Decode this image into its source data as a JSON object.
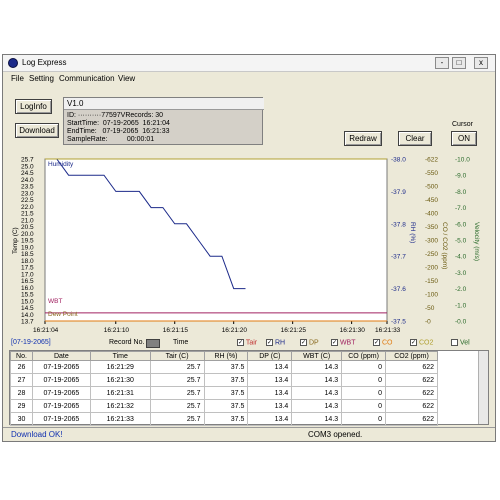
{
  "window": {
    "title": "Log Express",
    "controls": [
      "-",
      "□",
      "x"
    ]
  },
  "menu": [
    "File",
    "Setting",
    "Communication",
    "View"
  ],
  "buttons": {
    "loginfo": "LogInfo",
    "download": "Download",
    "redraw": "Redraw",
    "clear": "Clear",
    "cursor_label": "Cursor",
    "cursor_on": "ON"
  },
  "info": {
    "version": "V1.0",
    "id_line": "ID: ··········77597VRecords: 30",
    "start_time": "StartTime:  07-19-2065  16:21:04",
    "end_time": "EndTime:   07-19-2065  16:21:33",
    "sample_rate": "SampleRate:          00:00:01"
  },
  "chart_data": {
    "type": "line",
    "x": [
      "16:21:04",
      "16:21:10",
      "16:21:15",
      "16:21:20",
      "16:21:25",
      "16:21:30",
      "16:21:33"
    ],
    "xlabel": "",
    "date": "[07-19-2065]",
    "axes": {
      "left": {
        "label": "Temp (C)",
        "ticks": [
          "25.7",
          "25.0",
          "24.5",
          "24.0",
          "23.5",
          "23.0",
          "22.5",
          "22.0",
          "21.5",
          "21.0",
          "20.5",
          "20.0",
          "19.5",
          "19.0",
          "18.5",
          "18.0",
          "17.5",
          "17.0",
          "16.5",
          "16.0",
          "15.5",
          "15.0",
          "14.5",
          "14.0",
          "13.7"
        ],
        "ylim": [
          13.7,
          25.7
        ]
      },
      "right1": {
        "label": "RH (%)",
        "ticks": [
          "-38.0",
          "-37.9",
          "-37.8",
          "-37.7",
          "-37.6",
          "-37.5"
        ],
        "ylim": [
          37.5,
          38.0
        ]
      },
      "right2": {
        "label": "CO / CO2 (ppm)",
        "ticks": [
          "-622",
          "-550",
          "-500",
          "-450",
          "-400",
          "-350",
          "-300",
          "-250",
          "-200",
          "-150",
          "-100",
          "-50",
          "-0"
        ],
        "ylim": [
          0,
          622
        ]
      },
      "right3": {
        "label": "Velocity (m/s)",
        "ticks": [
          "-10.0",
          "-9.0",
          "-8.0",
          "-7.0",
          "-6.0",
          "-5.0",
          "-4.0",
          "-3.0",
          "-2.0",
          "-1.0",
          "-0.0"
        ],
        "ylim": [
          0,
          10
        ]
      }
    },
    "annotations": [
      "Humidity",
      "WBT",
      "Dew Point"
    ],
    "series": [
      {
        "name": "RH",
        "color": "#1c2a8a",
        "axis": "right1",
        "x_sec": [
          0,
          1,
          2,
          3,
          4,
          5,
          6,
          7,
          8,
          9,
          10,
          11,
          12,
          13,
          14,
          15,
          16,
          17
        ],
        "values": [
          38.0,
          38.0,
          37.95,
          37.95,
          37.95,
          37.95,
          37.9,
          37.9,
          37.9,
          37.85,
          37.85,
          37.8,
          37.8,
          37.75,
          37.7,
          37.7,
          37.6,
          37.6
        ]
      },
      {
        "name": "Tair",
        "color": "#c03030",
        "axis": "left",
        "x_sec": [
          0,
          29
        ],
        "values": [
          25.7,
          25.7
        ]
      },
      {
        "name": "DP",
        "color": "#8a6a20",
        "axis": "left",
        "x_sec": [
          0,
          29
        ],
        "values": [
          13.4,
          13.4
        ]
      },
      {
        "name": "WBT",
        "color": "#a02060",
        "axis": "left",
        "x_sec": [
          0,
          29
        ],
        "values": [
          14.3,
          14.3
        ]
      },
      {
        "name": "CO",
        "color": "#e07a10",
        "axis": "right2",
        "x_sec": [
          0,
          29
        ],
        "values": [
          0,
          0
        ]
      },
      {
        "name": "CO2",
        "color": "#b0a030",
        "axis": "right2",
        "x_sec": [
          0,
          29
        ],
        "values": [
          622,
          622
        ]
      }
    ]
  },
  "legend": {
    "record_no": "Record No.",
    "time": "Time",
    "items": [
      {
        "label": "Tair",
        "color": "#c03030",
        "checked": true
      },
      {
        "label": "RH",
        "color": "#1c2a8a",
        "checked": true
      },
      {
        "label": "DP",
        "color": "#8a6a20",
        "checked": true
      },
      {
        "label": "WBT",
        "color": "#a02060",
        "checked": true
      },
      {
        "label": "CO",
        "color": "#e07a10",
        "checked": true
      },
      {
        "label": "CO2",
        "color": "#b0a030",
        "checked": true
      },
      {
        "label": "Vel",
        "color": "#2a6a2a",
        "checked": false
      }
    ]
  },
  "table": {
    "headers": [
      "No.",
      "Date",
      "Time",
      "Tair (C)",
      "RH (%)",
      "DP (C)",
      "WBT (C)",
      "CO (ppm)",
      "CO2 (ppm)"
    ],
    "rows": [
      [
        "26",
        "07-19-2065",
        "16:21:29",
        "25.7",
        "37.5",
        "13.4",
        "14.3",
        "0",
        "622"
      ],
      [
        "27",
        "07-19-2065",
        "16:21:30",
        "25.7",
        "37.5",
        "13.4",
        "14.3",
        "0",
        "622"
      ],
      [
        "28",
        "07-19-2065",
        "16:21:31",
        "25.7",
        "37.5",
        "13.4",
        "14.3",
        "0",
        "622"
      ],
      [
        "29",
        "07-19-2065",
        "16:21:32",
        "25.7",
        "37.5",
        "13.4",
        "14.3",
        "0",
        "622"
      ],
      [
        "30",
        "07-19-2065",
        "16:21:33",
        "25.7",
        "37.5",
        "13.4",
        "14.3",
        "0",
        "622"
      ]
    ]
  },
  "status": {
    "left": "Download OK!",
    "right": "COM3 opened."
  }
}
